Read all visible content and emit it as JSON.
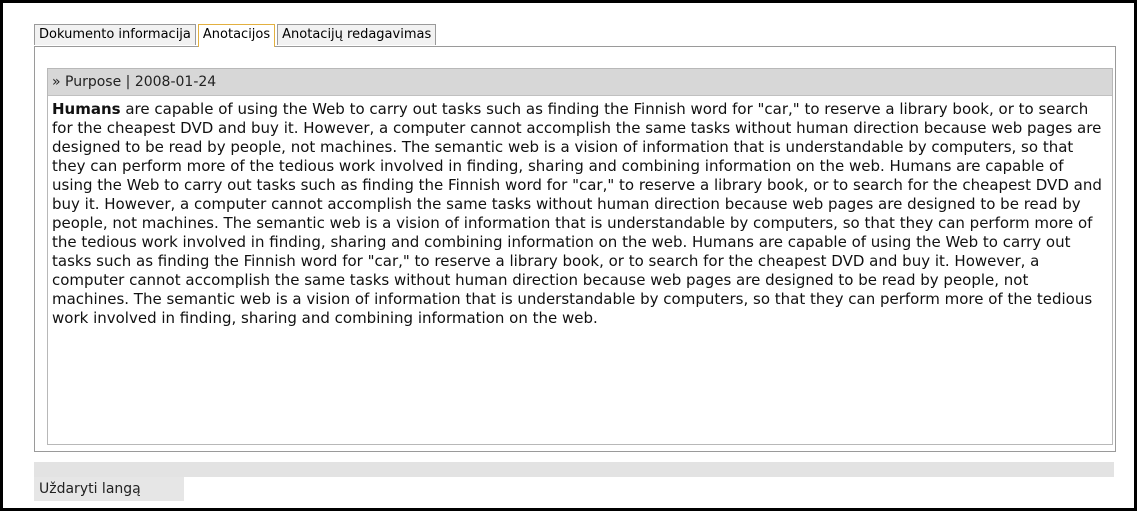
{
  "tabs": [
    {
      "label": "Dokumento informacija"
    },
    {
      "label": "Anotacijos"
    },
    {
      "label": "Anotacijų redagavimas"
    }
  ],
  "annotation": {
    "header": "» Purpose | 2008-01-24",
    "lead": "Humans",
    "text": " are capable of using the Web to carry out tasks such as finding the Finnish word for \"car,\" to reserve a library book, or to search for the cheapest DVD and buy it. However, a computer cannot accomplish the same tasks without human direction because web pages are designed to be read by people, not machines. The semantic web is a vision of information that is understandable by computers, so that they can perform more of the tedious work involved in finding, sharing and combining information on the web. Humans are capable of using the Web to carry out tasks such as finding the Finnish word for \"car,\" to reserve a library book, or to search for the cheapest DVD and buy it. However, a computer cannot accomplish the same tasks without human direction because web pages are designed to be read by people, not machines. The semantic web is a vision of information that is understandable by computers, so that they can perform more of the tedious work involved in finding, sharing and combining information on the web. Humans are capable of using the Web to carry out tasks such as finding the Finnish word for \"car,\" to reserve a library book, or to search for the cheapest DVD and buy it. However, a computer cannot accomplish the same tasks without human direction because web pages are designed to be read by people, not machines. The semantic web is a vision of information that is understandable by computers, so that they can perform more of the tedious work involved in finding, sharing and combining information on the web."
  },
  "footer": {
    "close_label": "Uždaryti langą"
  },
  "colors": {
    "active_tab_border": "#e2b040",
    "header_bg": "#d7d7d7"
  }
}
